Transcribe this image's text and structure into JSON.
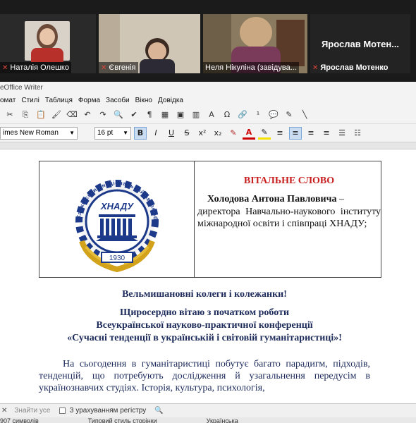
{
  "zoom": {
    "participants": [
      {
        "name": "Наталія Олешко",
        "muted": true
      },
      {
        "name": "Євгенія",
        "muted": true
      },
      {
        "name": "Неля  Нікуліна (завідува...",
        "muted": false,
        "active": true
      },
      {
        "name": "Ярослав Мотенко",
        "muted": true,
        "display_label": "Ярослав  Мотен..."
      }
    ]
  },
  "app": {
    "title": "eOffice Writer",
    "menu": [
      "омат",
      "Стилі",
      "Таблиця",
      "Форма",
      "Засоби",
      "Вікно",
      "Довідка"
    ]
  },
  "format": {
    "font_name": "imes New Roman",
    "font_size": "16 pt",
    "bold": "B",
    "italic": "I",
    "underline": "U",
    "strike": "S",
    "superscript": "x²",
    "subscript": "x₂"
  },
  "document": {
    "logo_top_text": "Харківський національний автомобільно-дорожній університет",
    "logo_abbr": "ХНАДУ",
    "logo_year": "1930",
    "greeting_title": "ВІТАЛЬНЕ СЛОВО",
    "greeting_name": "Холодова  Антона Павловича",
    "greeting_dash": " –",
    "greeting_role": "директора        Навчально-наукового інституту   міжнародної   освіти   і співпраці ХНАДУ;",
    "salutation": "Вельмишановні колеги і колежанки!",
    "welcome_line1": "Щиросердно вітаю з початком роботи",
    "welcome_line2": "Всеукраїнської науково-практичної конференції",
    "welcome_line3": "«Сучасні тенденції в українській і світовій гуманітаристиці»!",
    "paragraph": "На сьогодення в гуманітаристиці побутує багато парадигм, підходів, тенденцій, що потребують дослідження й узагальнення передусім в українознавчих студіях. Історія, культура, психологія,"
  },
  "find": {
    "placeholder": "Знайти усе",
    "match_case": "З урахуванням регістру"
  },
  "status": {
    "words": "907 символів",
    "page_style": "Типовий стиль сторінки",
    "language": "Українська"
  }
}
